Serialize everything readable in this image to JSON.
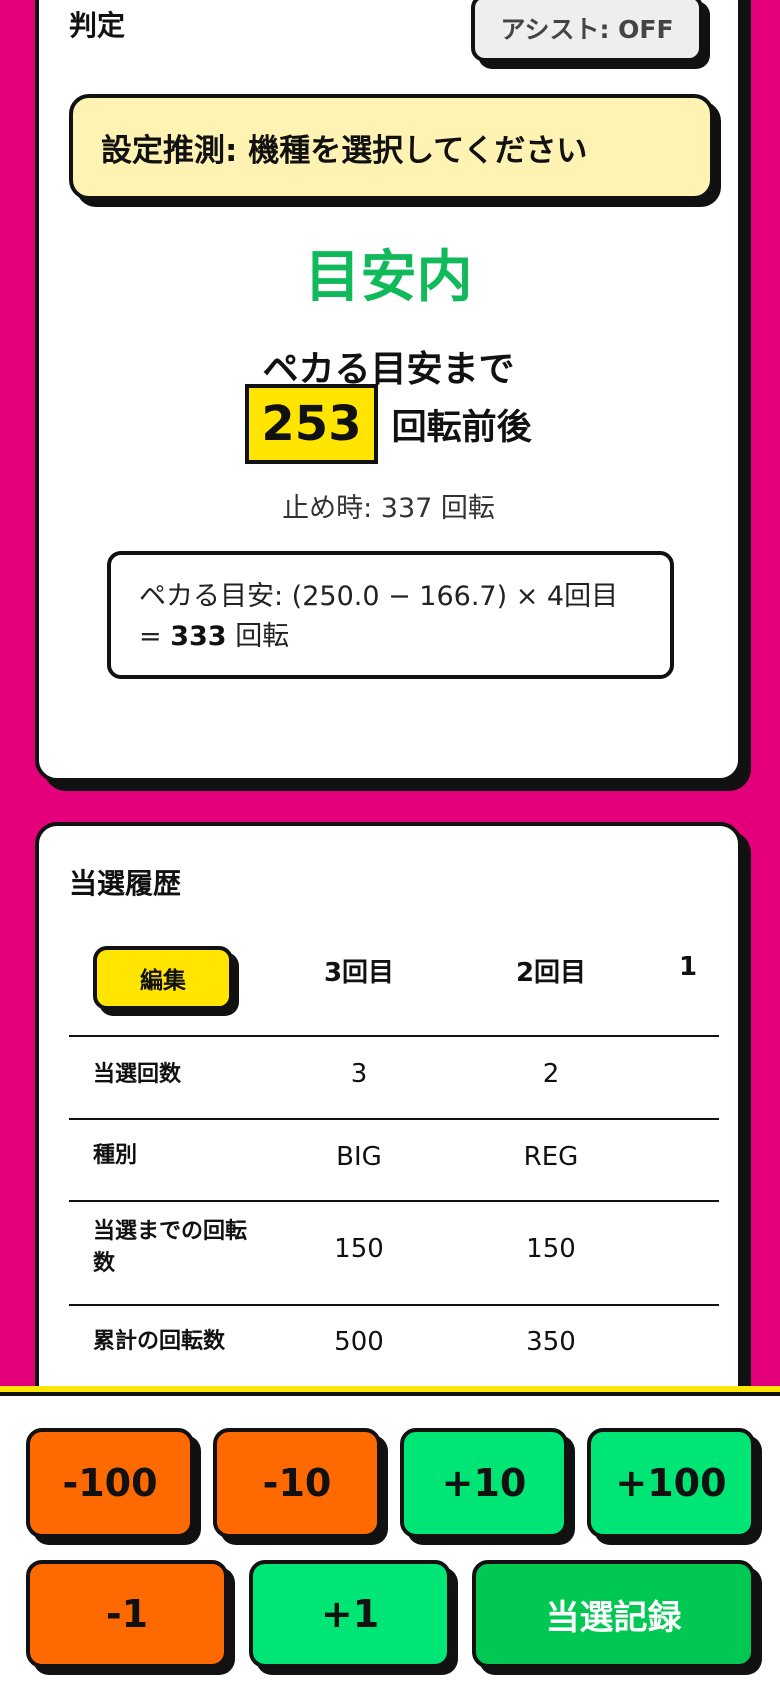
{
  "judge": {
    "label": "判定",
    "assist_button": "アシスト: OFF",
    "setting_estimate": "設定推測: 機種を選択してください",
    "status": "目安内",
    "until_label": "ペカる目安まで",
    "remaining_spins": "253",
    "spins_around": "回転前後",
    "stop_time_text": "止め時: 337 回転",
    "formula_line1": "ペカる目安: (250.0 − 166.7) × 4回目",
    "formula_eq": "=",
    "formula_value": "333",
    "formula_unit": "回転"
  },
  "history": {
    "title": "当選履歴",
    "edit_button": "編集",
    "columns": [
      "3回目",
      "2回目",
      "1"
    ],
    "rows": [
      {
        "label": "当選回数",
        "values": [
          "3",
          "2"
        ]
      },
      {
        "label": "種別",
        "values": [
          "BIG",
          "REG"
        ]
      },
      {
        "label": "当選までの回転数",
        "values": [
          "150",
          "150"
        ]
      },
      {
        "label": "累計の回転数",
        "values": [
          "500",
          "350"
        ]
      }
    ]
  },
  "controls": {
    "minus100": "-100",
    "minus10": "-10",
    "plus10": "+10",
    "plus100": "+100",
    "minus1": "-1",
    "plus1": "+1",
    "record": "当選記録"
  },
  "colors": {
    "background": "#E5007B",
    "status_green": "#10B95A",
    "highlight_yellow": "#FFE500",
    "estimate_bg": "#FFF3B3",
    "decrement_orange": "#FF6A00",
    "increment_green": "#00E676",
    "record_green": "#00C853"
  }
}
